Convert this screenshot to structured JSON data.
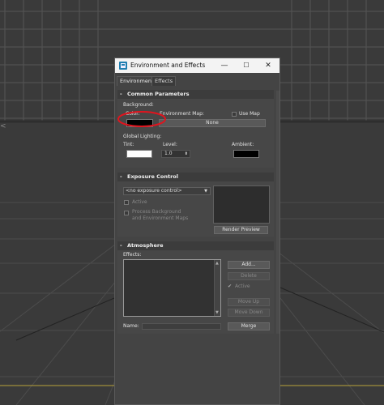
{
  "window": {
    "title": "Environment and Effects",
    "minimize": "—",
    "maximize": "☐",
    "close": "✕"
  },
  "tabs": [
    {
      "label": "Environment",
      "active": true
    },
    {
      "label": "Effects",
      "active": false
    }
  ],
  "common": {
    "header": "Common Parameters",
    "toggle": "-",
    "background_label": "Background:",
    "color_label": "Color:",
    "color_value": "#000000",
    "env_map_label": "Environment Map:",
    "use_map_label": "Use Map",
    "use_map_checked": false,
    "env_map_button": "None",
    "global_lighting_label": "Global Lighting:",
    "tint_label": "Tint:",
    "tint_value": "#ffffff",
    "level_label": "Level:",
    "level_value": "1.0",
    "ambient_label": "Ambient:",
    "ambient_value": "#000000"
  },
  "exposure": {
    "header": "Exposure Control",
    "toggle": "-",
    "dropdown_value": "<no exposure control>",
    "active_label": "Active",
    "process_label_1": "Process Background",
    "process_label_2": "and Environment Maps",
    "render_preview": "Render Preview"
  },
  "atmosphere": {
    "header": "Atmosphere",
    "toggle": "-",
    "effects_label": "Effects:",
    "add": "Add...",
    "delete": "Delete",
    "active_label": "Active",
    "active_checked": true,
    "move_up": "Move Up",
    "move_down": "Move Down",
    "name_label": "Name:",
    "name_value": "",
    "merge": "Merge"
  },
  "colors": {
    "accent_annotation": "#e0141e",
    "grid_line": "#565656",
    "horizon": "#b8a23a"
  }
}
